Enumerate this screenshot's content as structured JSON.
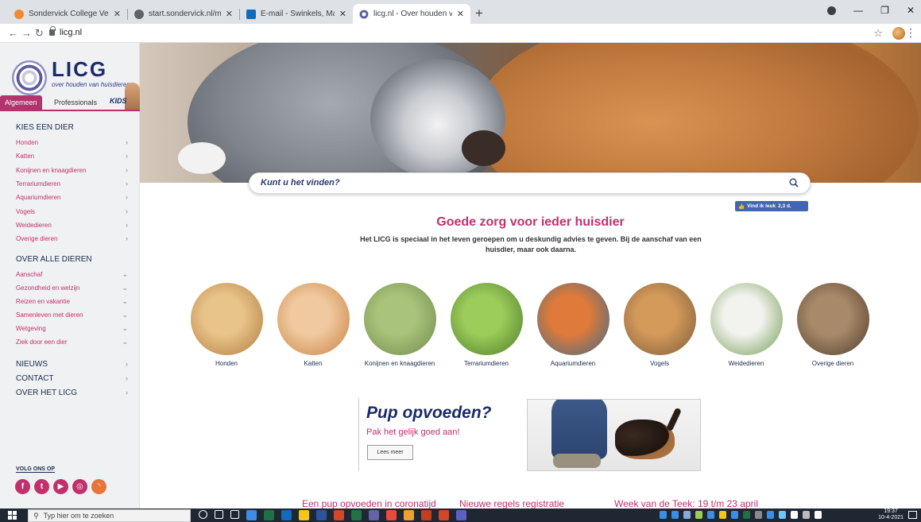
{
  "browser": {
    "tabs": [
      {
        "title": "Sondervick College Veldhoven - ",
        "color": "#f28b30",
        "active": false
      },
      {
        "title": "start.sondervick.nl/menu/",
        "color": "#5f6368",
        "active": false
      },
      {
        "title": "E-mail - Swinkels, Marieke - Outl",
        "color": "#0f6cbd",
        "active": false
      },
      {
        "title": "licg.nl - Over houden van huisdie",
        "color": "#9aa0a6",
        "active": true
      }
    ],
    "url": "licg.nl"
  },
  "sidebar": {
    "logo_text": "LICG",
    "logo_sub": "over houden van huisdieren",
    "audience_tabs": [
      "Algemeen",
      "Professionals",
      "KIDS"
    ],
    "section1_title": "KIES EEN DIER",
    "animals": [
      "Honden",
      "Katten",
      "Konijnen en knaagdieren",
      "Terrariumdieren",
      "Aquariumdieren",
      "Vogels",
      "Weidedieren",
      "Overige dieren"
    ],
    "section2_title": "OVER ALLE DIEREN",
    "topics": [
      "Aanschaf",
      "Gezondheid en welzijn",
      "Reizen en vakantie",
      "Samenleven met dieren",
      "Wetgeving",
      "Ziek door een dier"
    ],
    "main_links": [
      "NIEUWS",
      "CONTACT",
      "OVER HET LICG"
    ],
    "follow_label": "VOLG ONS OP",
    "socials": [
      {
        "name": "facebook",
        "glyph": "f",
        "color": "#c2306b"
      },
      {
        "name": "twitter",
        "glyph": "t",
        "color": "#c2306b"
      },
      {
        "name": "youtube",
        "glyph": "▶",
        "color": "#c2306b"
      },
      {
        "name": "instagram",
        "glyph": "◎",
        "color": "#c2306b"
      },
      {
        "name": "rss",
        "glyph": "◝",
        "color": "#e8743b"
      }
    ]
  },
  "search": {
    "placeholder": "Kunt u het vinden?"
  },
  "fb_like": {
    "label": "Vind ik leuk",
    "count": "2,3 d."
  },
  "main": {
    "headline": "Goede zorg voor ieder huisdier",
    "intro": "Het LICG is speciaal in het leven geroepen om u deskundig advies te geven. Bij de aanschaf van een huisdier, maar ook daarna.",
    "animal_tiles": [
      {
        "label": "Honden",
        "c1": "#e9c48a",
        "c2": "#b07a3e"
      },
      {
        "label": "Katten",
        "c1": "#f0c9a0",
        "c2": "#c8803e"
      },
      {
        "label": "Konijnen en knaagdieren",
        "c1": "#a9c37a",
        "c2": "#6f8a4e"
      },
      {
        "label": "Terrariumdieren",
        "c1": "#9ccc5a",
        "c2": "#4c7a2a"
      },
      {
        "label": "Aquariumdieren",
        "c1": "#e07a3a",
        "c2": "#3a6a8a"
      },
      {
        "label": "Vogels",
        "c1": "#d49a5a",
        "c2": "#7a5a3a"
      },
      {
        "label": "Weidedieren",
        "c1": "#f2f2ee",
        "c2": "#6f9a4e"
      },
      {
        "label": "Overige dieren",
        "c1": "#a88a6a",
        "c2": "#4e3a2a"
      }
    ],
    "promo": {
      "title": "Pup opvoeden?",
      "subtitle": "Pak het gelijk goed aan!",
      "button": "Lees meer"
    },
    "news": [
      "Een pup opvoeden in coronatijd",
      "Nieuwe regels registratie",
      "Week van de Teek: 19 t/m 23 april"
    ]
  },
  "taskbar": {
    "search_placeholder": "Typ hier om te zoeken",
    "time": "19:37",
    "date": "10-4-2021"
  }
}
